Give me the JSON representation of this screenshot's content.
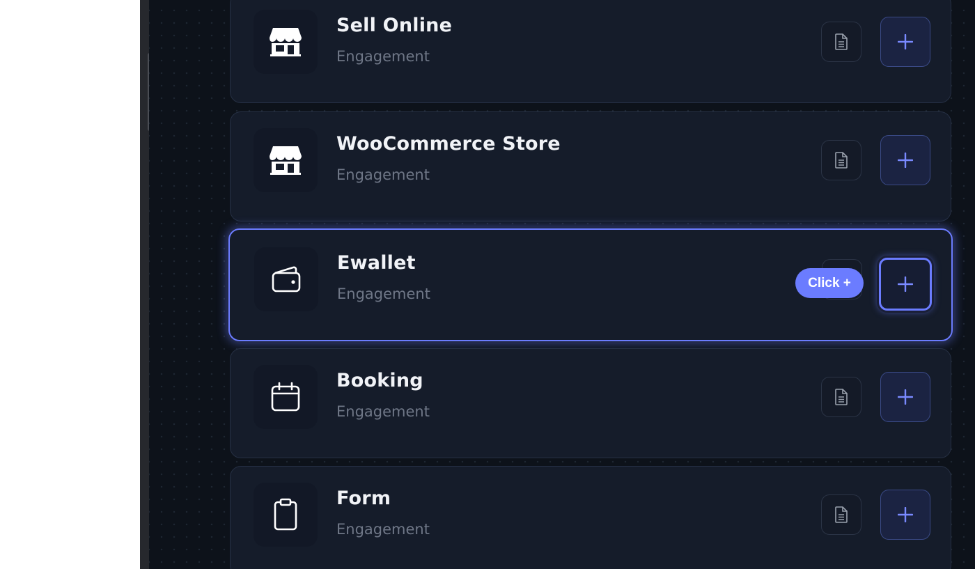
{
  "cards": [
    {
      "title": "Sell Online",
      "subtitle": "Engagement",
      "icon": "store-icon"
    },
    {
      "title": "WooCommerce Store",
      "subtitle": "Engagement",
      "icon": "store-icon"
    },
    {
      "title": "Ewallet",
      "subtitle": "Engagement",
      "icon": "wallet-icon",
      "highlighted": true
    },
    {
      "title": "Booking",
      "subtitle": "Engagement",
      "icon": "calendar-icon"
    },
    {
      "title": "Form",
      "subtitle": "Engagement",
      "icon": "clipboard-icon"
    }
  ],
  "tooltip": {
    "text": "Click +"
  },
  "buttons": {
    "add_label": "+",
    "doc_icon": "document-icon"
  },
  "colors": {
    "background": "#0d121a",
    "card": "#151c2a",
    "accent": "#6b7cff",
    "title": "#f1f3f7",
    "subtitle": "#6f7787"
  }
}
